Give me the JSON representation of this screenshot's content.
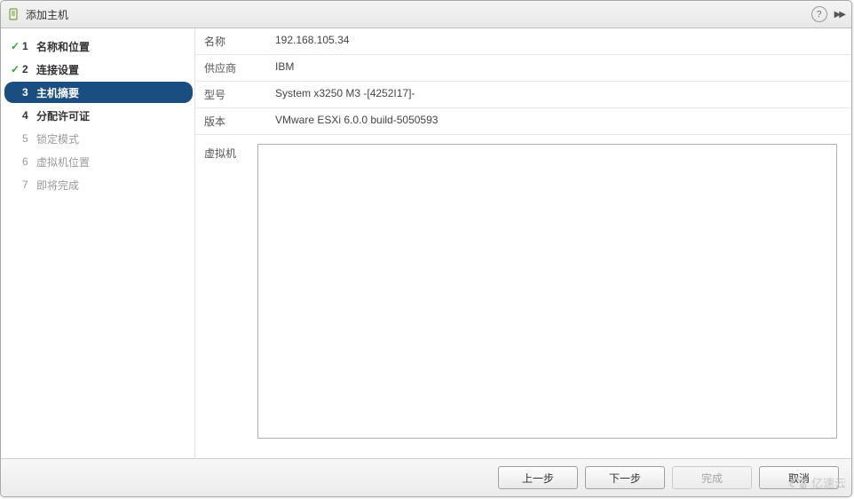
{
  "dialog": {
    "title": "添加主机"
  },
  "steps": [
    {
      "num": "1",
      "label": "名称和位置",
      "state": "completed"
    },
    {
      "num": "2",
      "label": "连接设置",
      "state": "completed"
    },
    {
      "num": "3",
      "label": "主机摘要",
      "state": "current"
    },
    {
      "num": "4",
      "label": "分配许可证",
      "state": "upcoming-active"
    },
    {
      "num": "5",
      "label": "锁定模式",
      "state": "disabled"
    },
    {
      "num": "6",
      "label": "虚拟机位置",
      "state": "disabled"
    },
    {
      "num": "7",
      "label": "即将完成",
      "state": "disabled"
    }
  ],
  "summary": {
    "name_label": "名称",
    "name_value": "192.168.105.34",
    "vendor_label": "供应商",
    "vendor_value": "IBM",
    "model_label": "型号",
    "model_value": "System x3250 M3 -[4252I17]-",
    "version_label": "版本",
    "version_value": "VMware ESXi 6.0.0 build-5050593",
    "vm_label": "虚拟机"
  },
  "buttons": {
    "back": "上一步",
    "next": "下一步",
    "finish": "完成",
    "cancel": "取消"
  },
  "watermark": "亿速云"
}
